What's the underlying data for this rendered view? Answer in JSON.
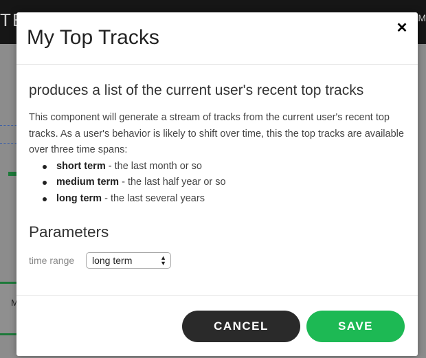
{
  "background": {
    "logo_text": "TE",
    "right_text": "AM"
  },
  "modal": {
    "title": "My Top Tracks",
    "close_glyph": "✕",
    "subtitle": "produces a list of the current user's recent top tracks",
    "description": "This component will generate a stream of tracks from the current user's recent top tracks. As a user's behavior is likely to shift over time, this the top tracks are available over three time spans:",
    "options": [
      {
        "term": "short term",
        "detail": " - the last month or so"
      },
      {
        "term": "medium term",
        "detail": " - the last half year or so"
      },
      {
        "term": "long term",
        "detail": " - the last several years"
      }
    ],
    "parameters_heading": "Parameters",
    "time_range": {
      "label": "time range",
      "selected": "long term"
    },
    "cancel_label": "CANCEL",
    "save_label": "SAVE"
  },
  "colors": {
    "accent_green": "#1db954",
    "cancel_dark": "#2a2a2a"
  }
}
